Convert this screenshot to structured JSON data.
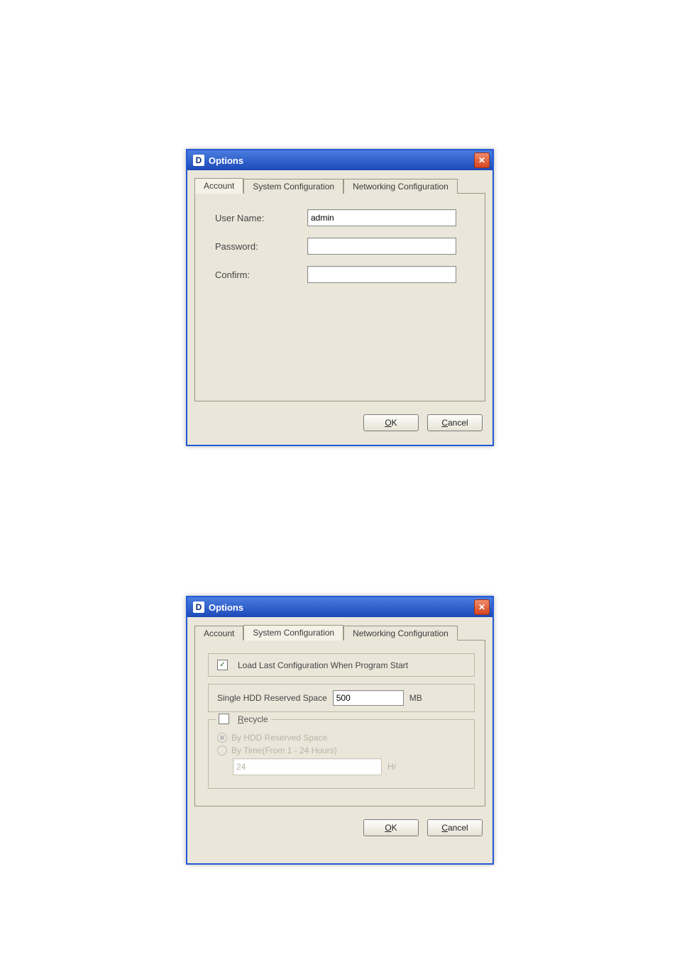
{
  "dialog_top": {
    "title": "Options",
    "icon_letter": "D",
    "tabs": [
      "Account",
      "System Configuration",
      "Networking Configuration"
    ],
    "active_tab": 0,
    "account": {
      "labels": {
        "user": "User Name:",
        "password": "Password:",
        "confirm": "Confirm:"
      },
      "values": {
        "user": "admin",
        "password": "",
        "confirm": ""
      }
    },
    "buttons": {
      "ok_letter": "O",
      "ok_rest": "K",
      "cancel_letter": "C",
      "cancel_rest": "ancel"
    }
  },
  "dialog_bottom": {
    "title": "Options",
    "icon_letter": "D",
    "tabs": [
      "Account",
      "System Configuration",
      "Networking Configuration"
    ],
    "active_tab": 1,
    "sys": {
      "load_last_label": "Load Last Configuration When Program Start",
      "load_last_checked": true,
      "hdd_label": "Single HDD Reserved Space",
      "hdd_value": "500",
      "hdd_unit": "MB",
      "recycle": {
        "title_letter": "R",
        "title_rest": "ecycle",
        "checked": false,
        "opts": {
          "by_space_label": "By HDD Reserved Space",
          "by_space_selected": true,
          "by_time_label": "By Time(From 1 - 24 Hours)",
          "by_time_selected": false,
          "time_value": "24",
          "time_unit": "Hr"
        }
      }
    },
    "buttons": {
      "ok_letter": "O",
      "ok_rest": "K",
      "cancel_letter": "C",
      "cancel_rest": "ancel"
    }
  }
}
